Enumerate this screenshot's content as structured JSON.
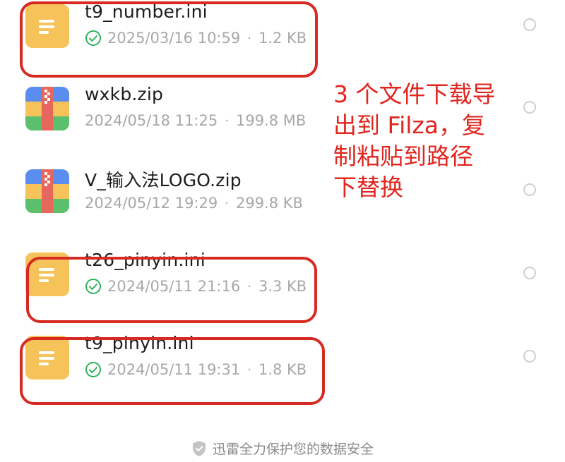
{
  "files": [
    {
      "name": "t9_number.ini",
      "type": "doc",
      "downloaded": true,
      "date": "2025/03/16 10:59",
      "size": "1.2 KB"
    },
    {
      "name": "wxkb.zip",
      "type": "zip",
      "downloaded": false,
      "date": "2024/05/18 11:25",
      "size": "199.8 MB"
    },
    {
      "name": "V_输入法LOGO.zip",
      "type": "zip",
      "downloaded": false,
      "date": "2024/05/12 19:29",
      "size": "299.8 KB"
    },
    {
      "name": "t26_pinyin.ini",
      "type": "doc",
      "downloaded": true,
      "date": "2024/05/11 21:16",
      "size": "3.3 KB"
    },
    {
      "name": "t9_pinyin.ini",
      "type": "doc",
      "downloaded": true,
      "date": "2024/05/11 19:31",
      "size": "1.8 KB"
    }
  ],
  "meta_separator": "·",
  "annotation": {
    "lines": [
      "3 个文件下载导",
      "出到 Filza，复",
      "制粘贴到路径",
      "下替换"
    ]
  },
  "footer": {
    "text": "迅雷全力保护您的数据安全",
    "icon": "shield-icon"
  },
  "colors": {
    "annotation": "#e0261f",
    "highlight_box": "#d62a23",
    "doc_icon": "#f6c25a",
    "check": "#2fb35c",
    "meta_text": "#a8a8a8"
  }
}
